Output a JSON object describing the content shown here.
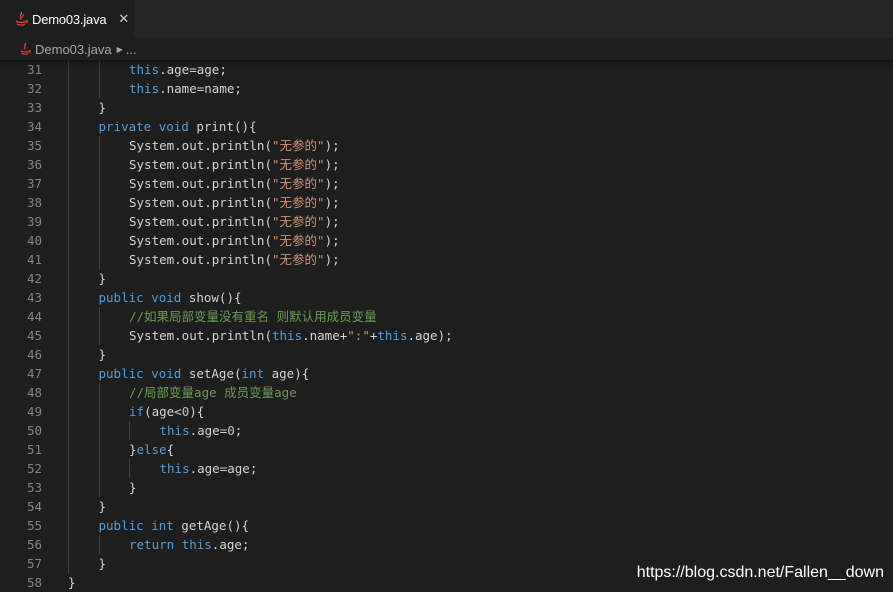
{
  "tab": {
    "title": "Demo03.java",
    "close": "✕"
  },
  "breadcrumb": {
    "file": "Demo03.java",
    "more": "..."
  },
  "colors": {
    "background": "#1e1e1e",
    "keyword": "#569cd6",
    "string": "#ce9178",
    "number": "#b5cea8",
    "comment": "#6a9955",
    "text": "#d4d4d4",
    "line_number": "#858585",
    "java_icon": "#e0483e"
  },
  "code_lines": [
    {
      "n": "31",
      "indent": 2,
      "tokens": [
        [
          "kw",
          "this"
        ],
        [
          "t",
          ".age=age;"
        ]
      ]
    },
    {
      "n": "32",
      "indent": 2,
      "tokens": [
        [
          "kw",
          "this"
        ],
        [
          "t",
          ".name=name;"
        ]
      ]
    },
    {
      "n": "33",
      "indent": 1,
      "tokens": [
        [
          "t",
          "}"
        ]
      ]
    },
    {
      "n": "34",
      "indent": 1,
      "tokens": [
        [
          "kw",
          "private"
        ],
        [
          "t",
          " "
        ],
        [
          "kw",
          "void"
        ],
        [
          "t",
          " print(){"
        ]
      ]
    },
    {
      "n": "35",
      "indent": 2,
      "tokens": [
        [
          "t",
          "System.out.println("
        ],
        [
          "str",
          "\"无参的\""
        ],
        [
          "t",
          ");"
        ]
      ]
    },
    {
      "n": "36",
      "indent": 2,
      "tokens": [
        [
          "t",
          "System.out.println("
        ],
        [
          "str",
          "\"无参的\""
        ],
        [
          "t",
          ");"
        ]
      ]
    },
    {
      "n": "37",
      "indent": 2,
      "tokens": [
        [
          "t",
          "System.out.println("
        ],
        [
          "str",
          "\"无参的\""
        ],
        [
          "t",
          ");"
        ]
      ]
    },
    {
      "n": "38",
      "indent": 2,
      "tokens": [
        [
          "t",
          "System.out.println("
        ],
        [
          "str",
          "\"无参的\""
        ],
        [
          "t",
          ");"
        ]
      ]
    },
    {
      "n": "39",
      "indent": 2,
      "tokens": [
        [
          "t",
          "System.out.println("
        ],
        [
          "str",
          "\"无参的\""
        ],
        [
          "t",
          ");"
        ]
      ]
    },
    {
      "n": "40",
      "indent": 2,
      "tokens": [
        [
          "t",
          "System.out.println("
        ],
        [
          "str",
          "\"无参的\""
        ],
        [
          "t",
          ");"
        ]
      ]
    },
    {
      "n": "41",
      "indent": 2,
      "tokens": [
        [
          "t",
          "System.out.println("
        ],
        [
          "str",
          "\"无参的\""
        ],
        [
          "t",
          ");"
        ]
      ]
    },
    {
      "n": "42",
      "indent": 1,
      "tokens": [
        [
          "t",
          "}"
        ]
      ]
    },
    {
      "n": "43",
      "indent": 1,
      "tokens": [
        [
          "kw",
          "public"
        ],
        [
          "t",
          " "
        ],
        [
          "kw",
          "void"
        ],
        [
          "t",
          " show(){"
        ]
      ]
    },
    {
      "n": "44",
      "indent": 2,
      "tokens": [
        [
          "cmt",
          "//如果局部变量没有重名 则默认用成员变量"
        ]
      ]
    },
    {
      "n": "45",
      "indent": 2,
      "tokens": [
        [
          "t",
          "System.out.println("
        ],
        [
          "kw",
          "this"
        ],
        [
          "t",
          ".name+"
        ],
        [
          "str",
          "\":\""
        ],
        [
          "t",
          "+"
        ],
        [
          "kw",
          "this"
        ],
        [
          "t",
          ".age);"
        ]
      ]
    },
    {
      "n": "46",
      "indent": 1,
      "tokens": [
        [
          "t",
          "}"
        ]
      ]
    },
    {
      "n": "47",
      "indent": 1,
      "tokens": [
        [
          "kw",
          "public"
        ],
        [
          "t",
          " "
        ],
        [
          "kw",
          "void"
        ],
        [
          "t",
          " setAge("
        ],
        [
          "kw",
          "int"
        ],
        [
          "t",
          " age){"
        ]
      ]
    },
    {
      "n": "48",
      "indent": 2,
      "tokens": [
        [
          "cmt",
          "//局部变量age 成员变量age"
        ]
      ]
    },
    {
      "n": "49",
      "indent": 2,
      "tokens": [
        [
          "kw",
          "if"
        ],
        [
          "t",
          "(age<"
        ],
        [
          "num",
          "0"
        ],
        [
          "t",
          "){"
        ]
      ]
    },
    {
      "n": "50",
      "indent": 3,
      "tokens": [
        [
          "kw",
          "this"
        ],
        [
          "t",
          ".age="
        ],
        [
          "num",
          "0"
        ],
        [
          "t",
          ";"
        ]
      ]
    },
    {
      "n": "51",
      "indent": 2,
      "tokens": [
        [
          "t",
          "}"
        ],
        [
          "kw",
          "else"
        ],
        [
          "t",
          "{"
        ]
      ]
    },
    {
      "n": "52",
      "indent": 3,
      "tokens": [
        [
          "kw",
          "this"
        ],
        [
          "t",
          ".age=age;"
        ]
      ]
    },
    {
      "n": "53",
      "indent": 2,
      "tokens": [
        [
          "t",
          "}"
        ]
      ]
    },
    {
      "n": "54",
      "indent": 1,
      "tokens": [
        [
          "t",
          "}"
        ]
      ]
    },
    {
      "n": "55",
      "indent": 1,
      "tokens": [
        [
          "kw",
          "public"
        ],
        [
          "t",
          " "
        ],
        [
          "kw",
          "int"
        ],
        [
          "t",
          " getAge(){"
        ]
      ]
    },
    {
      "n": "56",
      "indent": 2,
      "tokens": [
        [
          "kw",
          "return"
        ],
        [
          "t",
          " "
        ],
        [
          "kw",
          "this"
        ],
        [
          "t",
          ".age;"
        ]
      ]
    },
    {
      "n": "57",
      "indent": 1,
      "tokens": [
        [
          "t",
          "}"
        ]
      ]
    },
    {
      "n": "58",
      "indent": 0,
      "tokens": [
        [
          "t",
          "}"
        ]
      ]
    }
  ],
  "watermark": "https://blog.csdn.net/Fallen__down"
}
